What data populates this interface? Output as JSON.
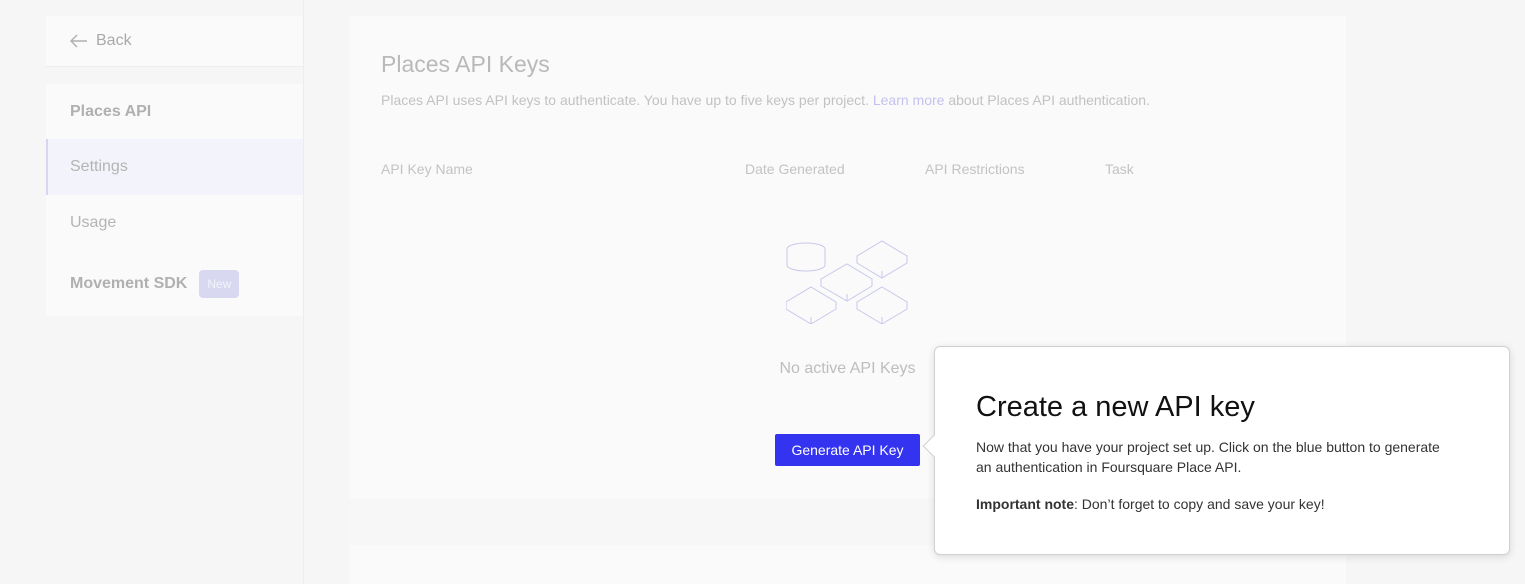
{
  "sidebar": {
    "back_label": "Back",
    "section_title": "Places API",
    "items": [
      {
        "label": "Settings",
        "active": true
      },
      {
        "label": "Usage",
        "active": false
      }
    ],
    "movement": {
      "label": "Movement SDK",
      "badge": "New"
    }
  },
  "main": {
    "title": "Places API Keys",
    "description_prefix": "Places API uses API keys to authenticate. You have up to five keys per project.",
    "description_link": "Learn more",
    "description_suffix": "about Places API authentication.",
    "table_headers": [
      "API Key Name",
      "Date Generated",
      "API Restrictions",
      "Task"
    ],
    "empty_state": "No active API Keys",
    "generate_button": "Generate API Key"
  },
  "tooltip": {
    "title": "Create a new API key",
    "body": "Now that you have your project set up. Click on the blue button to generate an authentication in Foursquare Place API.",
    "note_label": "Important note",
    "note_text": ": Don’t forget to copy and save your key!"
  },
  "colors": {
    "accent": "#3333f0",
    "badge_bg": "#d8d8f1"
  }
}
